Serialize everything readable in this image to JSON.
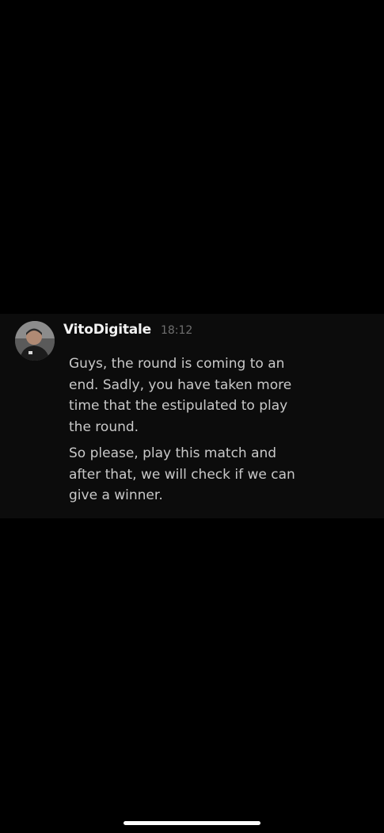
{
  "message": {
    "username": "VitoDigitale",
    "timestamp": "18:12",
    "paragraphs": [
      "Guys, the round is coming to an\nend. Sadly, you have taken more\ntime that the estipulated to play\nthe round.",
      "So please, play this match and\nafter that, we will check if we can\ngive a winner."
    ]
  },
  "colors": {
    "background": "#000000",
    "card": "#0c0c0c",
    "username": "#f2f2f2",
    "timestamp": "#6f6f6f",
    "text": "#c9c9c9"
  },
  "icons": {
    "avatar": "user-profile-photo",
    "home_indicator": "home-bar"
  }
}
